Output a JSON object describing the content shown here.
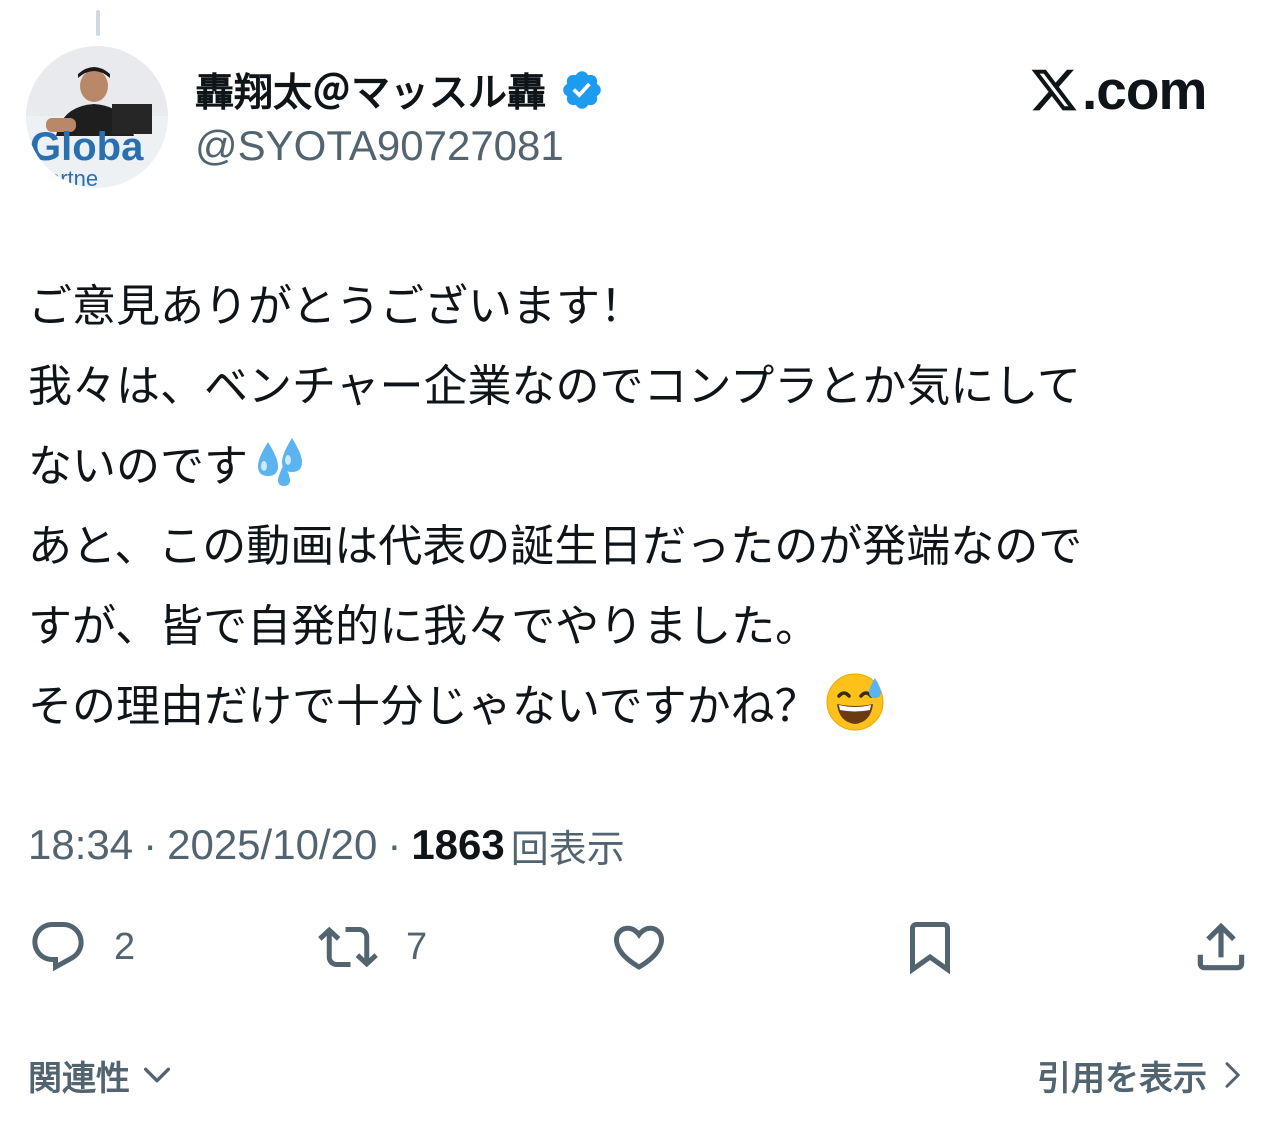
{
  "author": {
    "display_name": "轟翔太＠マッスル轟",
    "handle": "@SYOTA90727081",
    "verified": true,
    "avatar_text": "Globa",
    "avatar_text_2": "artne"
  },
  "site": {
    "logo_text": ".com",
    "logo_icon": "x-logo-icon"
  },
  "tweet": {
    "lines": [
      "ご意見ありがとうございます！",
      "我々は、ベンチャー企業なのでコンプラとか気にして",
      "ないのです",
      "あと、この動画は代表の誕生日だったのが発端なので",
      "すが、皆で自発的に我々でやりました。",
      "その理由だけで十分じゃないですかね？"
    ],
    "emojis": [
      "sweat-droplets-emoji",
      "grinning-face-with-sweat-emoji"
    ]
  },
  "meta": {
    "time": "18:34",
    "separator": "·",
    "date": "2025/10/20",
    "views_count": "1863",
    "views_label": "回表示"
  },
  "actions": {
    "reply_count": "2",
    "repost_count": "7"
  },
  "footer": {
    "relevance_label": "関連性",
    "quotes_label": "引用を表示"
  },
  "colors": {
    "text_primary": "#0f1419",
    "text_secondary": "#536471",
    "verified_blue": "#1d9bf0",
    "thread_line": "#cfd9de"
  }
}
